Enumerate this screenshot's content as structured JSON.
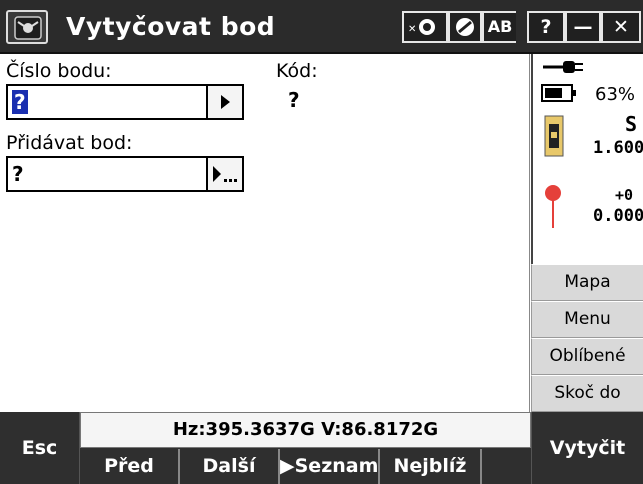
{
  "titlebar": {
    "title": "Vytyčovat bod",
    "buttons": [
      "?",
      "—",
      "✕"
    ],
    "ab_label": "AB"
  },
  "form": {
    "point_label": "Číslo bodu:",
    "point_value": "?",
    "code_label": "Kód:",
    "code_value": "?",
    "add_label": "Přidávat bod:",
    "add_value": "?"
  },
  "status": {
    "battery_percent": "63%",
    "s_label": "S",
    "height_value": "1.600",
    "offset_label": "+0",
    "target_value": "0.000"
  },
  "side_menu": [
    "Mapa",
    "Menu",
    "Oblíbené",
    "Skoč do"
  ],
  "bottom": {
    "esc_label": "Esc",
    "angle_readout": "Hz:395.3637G  V:86.8172G",
    "softkeys": [
      "Před",
      "Další",
      "Seznam",
      "Nejblíž"
    ],
    "seznam_prefix": "▶",
    "action_label": "Vytyčit"
  },
  "colors": {
    "titlebar": "#2b2b2b",
    "selection": "#1a2fb0",
    "accent_pin": "#e5403a"
  }
}
